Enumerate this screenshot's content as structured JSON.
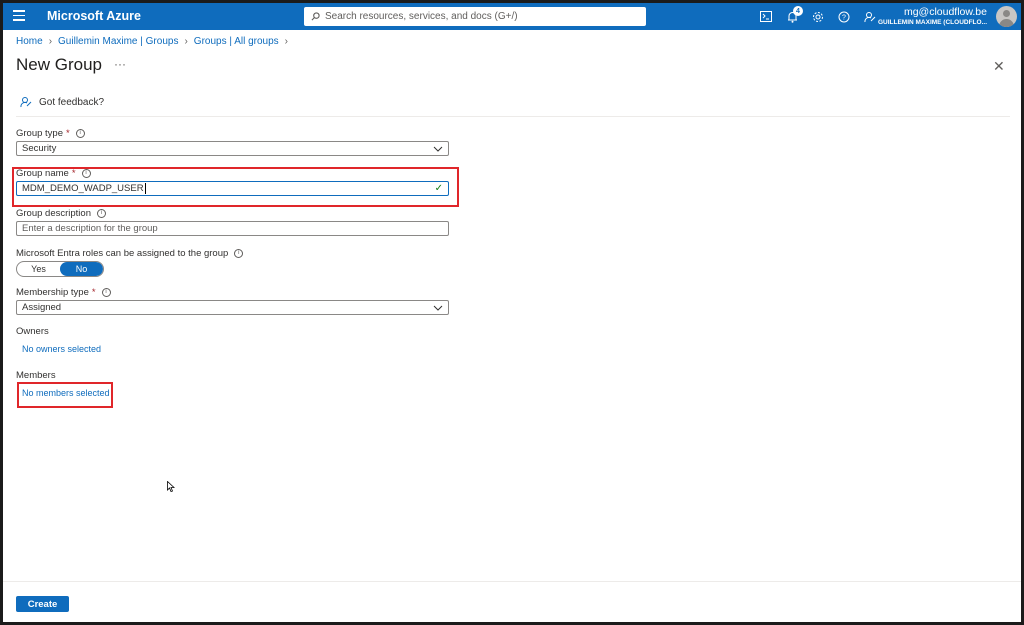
{
  "topbar": {
    "brand": "Microsoft Azure",
    "search_placeholder": "Search resources, services, and docs (G+/)",
    "notification_count": "4",
    "account_email": "mg@cloudflow.be",
    "account_tenant": "GUILLEMIN MAXIME (CLOUDFLO..."
  },
  "breadcrumb": [
    "Home",
    "Guillemin Maxime | Groups",
    "Groups | All groups"
  ],
  "page": {
    "title": "New Group",
    "more": "···",
    "feedback": "Got feedback?"
  },
  "form": {
    "group_type_label": "Group type",
    "group_type_value": "Security",
    "group_name_label": "Group name",
    "group_name_value": "MDM_DEMO_WADP_USER",
    "group_description_label": "Group description",
    "group_description_placeholder": "Enter a description for the group",
    "entra_roles_label": "Microsoft Entra roles can be assigned to the group",
    "toggle_yes": "Yes",
    "toggle_no": "No",
    "toggle_selected": "No",
    "membership_type_label": "Membership type",
    "membership_type_value": "Assigned",
    "owners_label": "Owners",
    "owners_link": "No owners selected",
    "members_label": "Members",
    "members_link": "No members selected",
    "required_mark": "*"
  },
  "footer": {
    "create_label": "Create"
  },
  "colors": {
    "accent": "#0f6cbd",
    "highlight": "#e0262a",
    "required": "#a4262c"
  }
}
